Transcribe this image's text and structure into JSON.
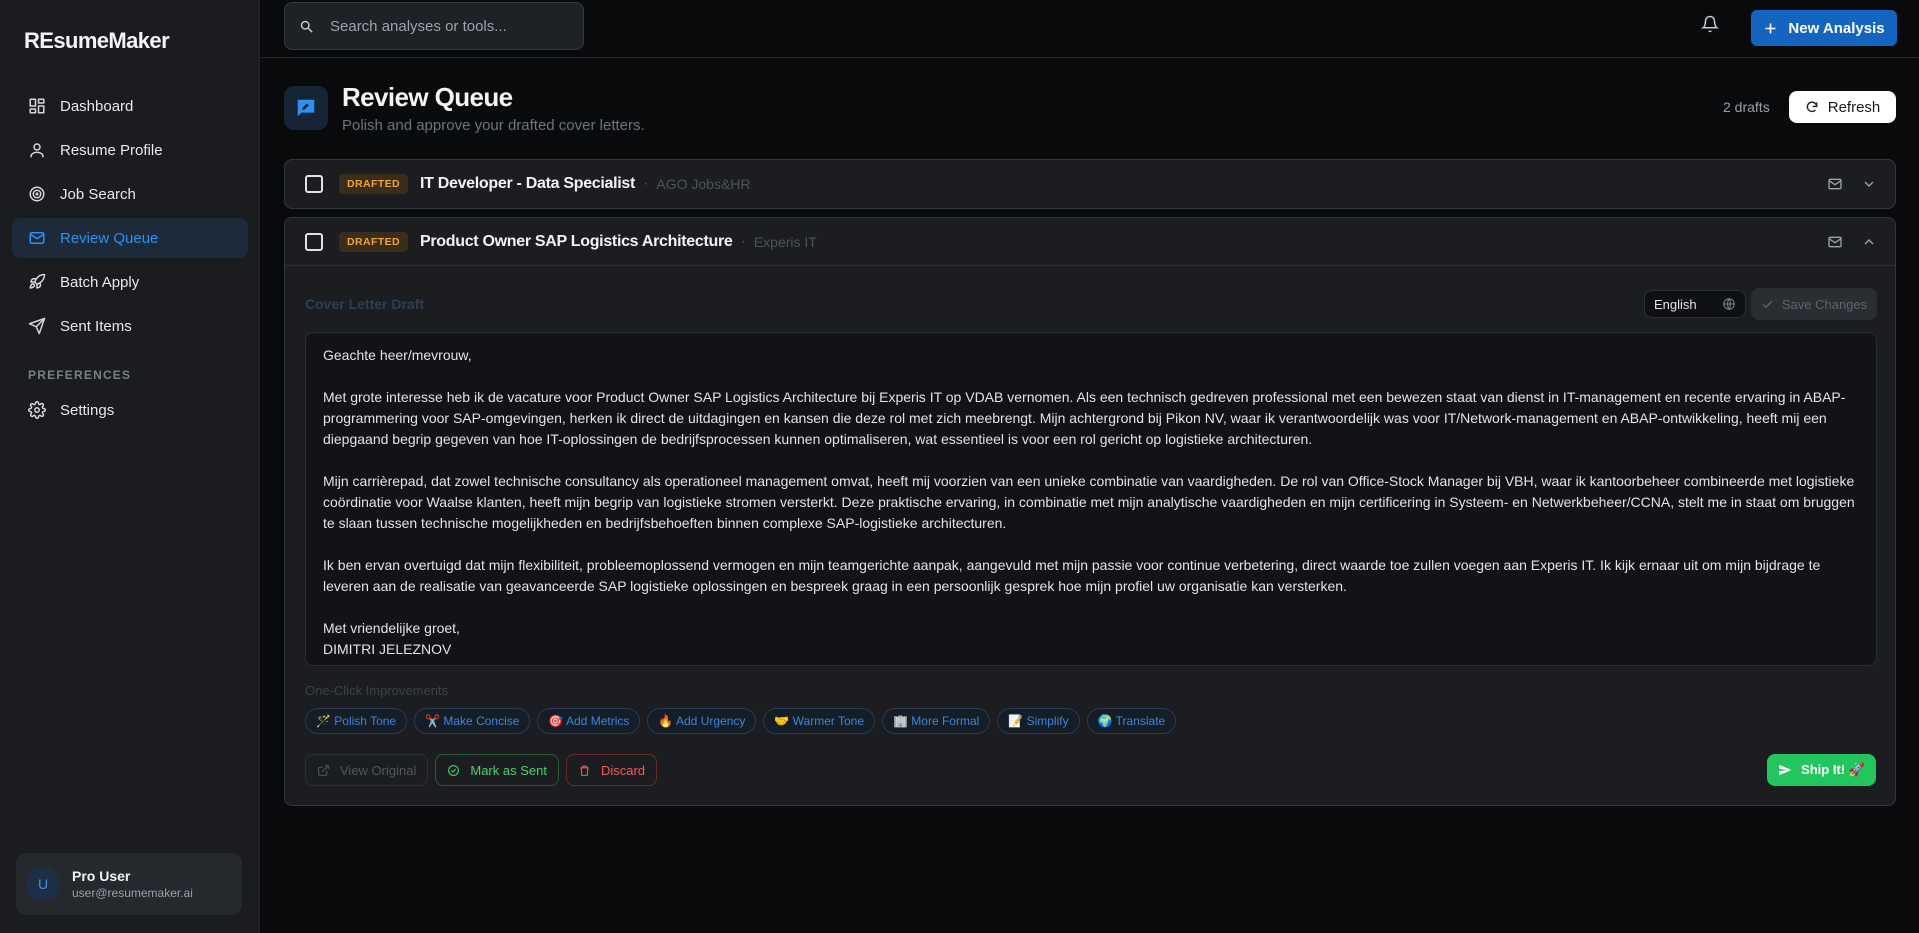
{
  "app": {
    "brand": "REsumeMaker"
  },
  "sidebar": {
    "items": [
      {
        "label": "Dashboard",
        "icon": "dashboard-icon"
      },
      {
        "label": "Resume Profile",
        "icon": "user-icon"
      },
      {
        "label": "Job Search",
        "icon": "target-icon"
      },
      {
        "label": "Review Queue",
        "icon": "mail-icon",
        "active": true
      },
      {
        "label": "Batch Apply",
        "icon": "rocket-icon"
      },
      {
        "label": "Sent Items",
        "icon": "send-icon"
      }
    ],
    "section_label": "PREFERENCES",
    "settings_label": "Settings",
    "user": {
      "initial": "U",
      "name": "Pro User",
      "email": "user@resumemaker.ai"
    }
  },
  "topbar": {
    "search_placeholder": "Search analyses or tools...",
    "new_button": "New Analysis"
  },
  "page": {
    "title": "Review Queue",
    "subtitle": "Polish and approve your drafted cover letters.",
    "drafts_count": "2 drafts",
    "refresh_label": "Refresh"
  },
  "drafts": [
    {
      "status": "DRAFTED",
      "title": "IT Developer - Data Specialist",
      "company": "AGO Jobs&HR",
      "expanded": false
    },
    {
      "status": "DRAFTED",
      "title": "Product Owner SAP Logistics Architecture",
      "company": "Experis IT",
      "expanded": true
    }
  ],
  "editor": {
    "label": "Cover Letter Draft",
    "language": "English",
    "save_label": "Save Changes",
    "letter": {
      "greeting": "Geachte heer/mevrouw,",
      "p1": "Met grote interesse heb ik de vacature voor Product Owner SAP Logistics Architecture bij Experis IT op VDAB vernomen. Als een technisch gedreven professional met een bewezen staat van dienst in IT-management en recente ervaring in ABAP-programmering voor SAP-omgevingen, herken ik direct de uitdagingen en kansen die deze rol met zich meebrengt. Mijn achtergrond bij Pikon NV, waar ik verantwoordelijk was voor IT/Network-management en ABAP-ontwikkeling, heeft mij een diepgaand begrip gegeven van hoe IT-oplossingen de bedrijfsprocessen kunnen optimaliseren, wat essentieel is voor een rol gericht op logistieke architecturen.",
      "p2": "Mijn carrièrepad, dat zowel technische consultancy als operationeel management omvat, heeft mij voorzien van een unieke combinatie van vaardigheden. De rol van Office-Stock Manager bij VBH, waar ik kantoorbeheer combineerde met logistieke coördinatie voor Waalse klanten, heeft mijn begrip van logistieke stromen versterkt. Deze praktische ervaring, in combinatie met mijn analytische vaardigheden en mijn certificering in Systeem- en Netwerkbeheer/CCNA, stelt me in staat om bruggen te slaan tussen technische mogelijkheden en bedrijfsbehoeften binnen complexe SAP-logistieke architecturen.",
      "p3": "Ik ben ervan overtuigd dat mijn flexibiliteit, probleemoplossend vermogen en mijn teamgerichte aanpak, aangevuld met mijn passie voor continue verbetering, direct waarde toe zullen voegen aan Experis IT. Ik kijk ernaar uit om mijn bijdrage te leveren aan de realisatie van geavanceerde SAP logistieke oplossingen en bespreek graag in een persoonlijk gesprek hoe mijn profiel uw organisatie kan versterken.",
      "closing": "Met vriendelijke groet,",
      "signature": "DIMITRI JELEZNOV"
    },
    "improvements_label": "One-Click Improvements",
    "improvements": [
      "🪄 Polish Tone",
      "✂️ Make Concise",
      "🎯 Add Metrics",
      "🔥 Add Urgency",
      "🤝 Warmer Tone",
      "🏢 More Formal",
      "📝 Simplify",
      "🌍 Translate"
    ],
    "actions": {
      "view_original": "View Original",
      "mark_sent": "Mark as Sent",
      "discard": "Discard",
      "ship": "Ship It! 🚀"
    }
  },
  "colors": {
    "accent": "#2f8ff2",
    "primary_button": "#1565c0",
    "draft_badge": "#f0a53a",
    "success": "#22c55e",
    "danger": "#f05b5b"
  }
}
